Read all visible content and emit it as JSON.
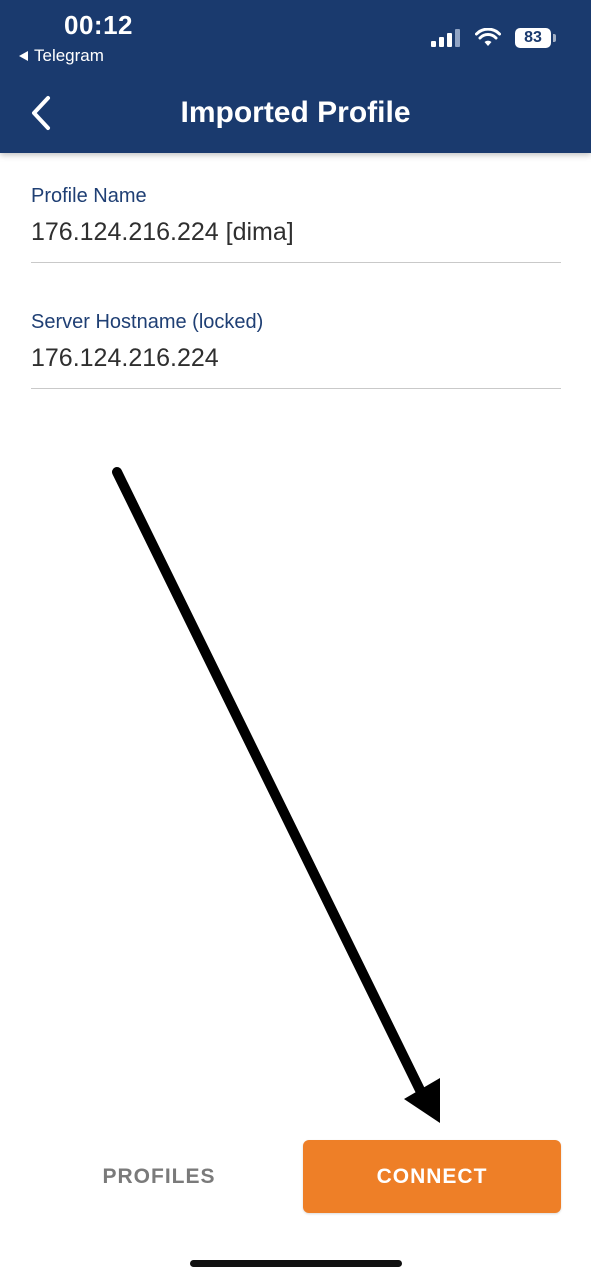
{
  "status_bar": {
    "time": "00:12",
    "back_app": "Telegram",
    "battery": "83"
  },
  "header": {
    "title": "Imported Profile",
    "back_icon": "chevron-left-icon"
  },
  "form": {
    "profile_name": {
      "label": "Profile Name",
      "value": "176.124.216.224 [dima]"
    },
    "server_hostname": {
      "label": "Server Hostname (locked)",
      "value": "176.124.216.224"
    }
  },
  "actions": {
    "profiles_label": "PROFILES",
    "connect_label": "CONNECT"
  },
  "colors": {
    "header_bg": "#1a3a6e",
    "accent": "#ee7f27",
    "label": "#1f3f74"
  }
}
